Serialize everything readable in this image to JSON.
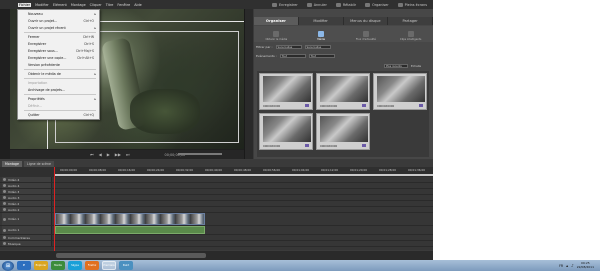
{
  "menubar": {
    "items": [
      "Fichier",
      "Modifier",
      "Elément",
      "Montage",
      "Cliquer",
      "Titre",
      "Fenêtre",
      "Aide"
    ],
    "active_index": 0
  },
  "window_tools": {
    "items": [
      "Enregistrer",
      "Annuler",
      "Rétablir",
      "Organiser",
      "Pleins écrans"
    ]
  },
  "file_menu": {
    "items": [
      {
        "label": "Nouveau",
        "shortcut": "",
        "submenu": true,
        "disabled": false
      },
      {
        "label": "Ouvrir un projet...",
        "shortcut": "Ctrl+O",
        "submenu": false,
        "disabled": false
      },
      {
        "label": "Ouvrir un projet récent",
        "shortcut": "",
        "submenu": true,
        "disabled": false
      },
      {
        "label": "Fermer",
        "shortcut": "Ctrl+W",
        "submenu": false,
        "disabled": false
      },
      {
        "label": "Enregistrer",
        "shortcut": "Ctrl+S",
        "submenu": false,
        "disabled": false
      },
      {
        "label": "Enregistrer sous...",
        "shortcut": "Ctrl+Maj+S",
        "submenu": false,
        "disabled": false
      },
      {
        "label": "Enregistrer une copie...",
        "shortcut": "Ctrl+Alt+S",
        "submenu": false,
        "disabled": false
      },
      {
        "label": "Version précédente",
        "shortcut": "",
        "submenu": false,
        "disabled": false
      },
      {
        "label": "Obtenir le média de",
        "shortcut": "",
        "submenu": true,
        "disabled": false
      },
      {
        "label": "Importation",
        "shortcut": "",
        "submenu": false,
        "disabled": true
      },
      {
        "label": "Archivage de projets...",
        "shortcut": "",
        "submenu": false,
        "disabled": false
      },
      {
        "label": "Propriétés",
        "shortcut": "",
        "submenu": true,
        "disabled": false
      },
      {
        "label": "Définir...",
        "shortcut": "",
        "submenu": false,
        "disabled": true
      },
      {
        "label": "Quitter",
        "shortcut": "Ctrl+Q",
        "submenu": false,
        "disabled": false
      }
    ]
  },
  "transport": {
    "buttons": [
      "⏮",
      "◀",
      "▶",
      "▶▶",
      "⏭"
    ],
    "timecode": "00;00;00;00"
  },
  "organizer": {
    "tabs": [
      "Organiser",
      "Modifier",
      "Menus du disque",
      "Partager"
    ],
    "active_tab": 0,
    "subtabs": [
      "Obtenir le média",
      "Média",
      "Flux d'actualité",
      "Clips intelligents"
    ],
    "active_subtab": 1,
    "filter_label": "Filtrer par :",
    "filter_value": "Sans balise",
    "filter_value2": "Sans balise",
    "event_label": "Evénements :",
    "event_value": "Tout",
    "event_value2": "Tout",
    "sort_value": "Plus récents",
    "sort_checkbox": "Echelle",
    "clips": [
      "00000X0000",
      "00000X0000",
      "00000X0000",
      "00000X0000",
      "00000X0000"
    ]
  },
  "timeline": {
    "tabs": [
      "Montage",
      "Ligne de scène"
    ],
    "active_tab": 0,
    "ruler_labels": [
      "00;00;00;00",
      "00;00;08;00",
      "00;00;16;00",
      "00;00;24;00",
      "00;00;32;00",
      "00;00;40;00",
      "00;00;48;00",
      "00;00;56;00",
      "00;01;04;00",
      "00;01;12;00",
      "00;01;20;00",
      "00;01;28;00",
      "00;01;36;00"
    ],
    "tracks": [
      "Vidéo 4",
      "Audio 4",
      "Vidéo 3",
      "Audio 3",
      "Vidéo 2",
      "Audio 2",
      "Vidéo 1",
      "Audio 1",
      "Commentaires",
      "Musique"
    ]
  },
  "taskbar": {
    "language": "FR",
    "time": "09:25",
    "date": "22/08/2011",
    "apps": [
      "IE",
      "Explorer",
      "Media",
      "Skype",
      "Firefox",
      "Premiere",
      "Paint"
    ]
  },
  "colors": {
    "panel": "#3b3b3b",
    "accent": "#8cb8e8",
    "playhead": "#dd2222",
    "audio_clip": "#5a8a4a"
  }
}
